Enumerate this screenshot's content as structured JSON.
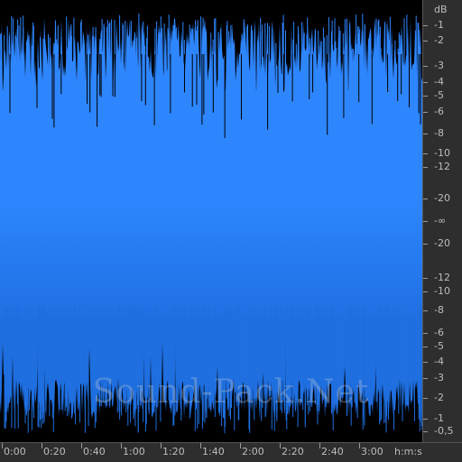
{
  "watermark": "Sound-Pack.Net",
  "colors": {
    "waveform": "#2e86ff",
    "waveform_dark": "#1f6fe0",
    "background": "#000000",
    "ruler_bg": "#2e2e2e",
    "ruler_text": "#bdbdbd"
  },
  "db_scale": {
    "unit_label": "dB",
    "labels": [
      "-1",
      "-2",
      "-3",
      "-4",
      "-5",
      "-6",
      "-8",
      "-10",
      "-12",
      "-20",
      "-∞",
      "-20",
      "-12",
      "-10",
      "-8",
      "-6",
      "-5",
      "-4",
      "-3",
      "-2",
      "-1",
      "-0,5"
    ]
  },
  "time_scale": {
    "labels": [
      "0:00",
      "0:20",
      "0:40",
      "1:00",
      "1:20",
      "1:40",
      "2:00",
      "2:20",
      "2:40",
      "3:00"
    ],
    "unit_label": "h:m:s"
  }
}
